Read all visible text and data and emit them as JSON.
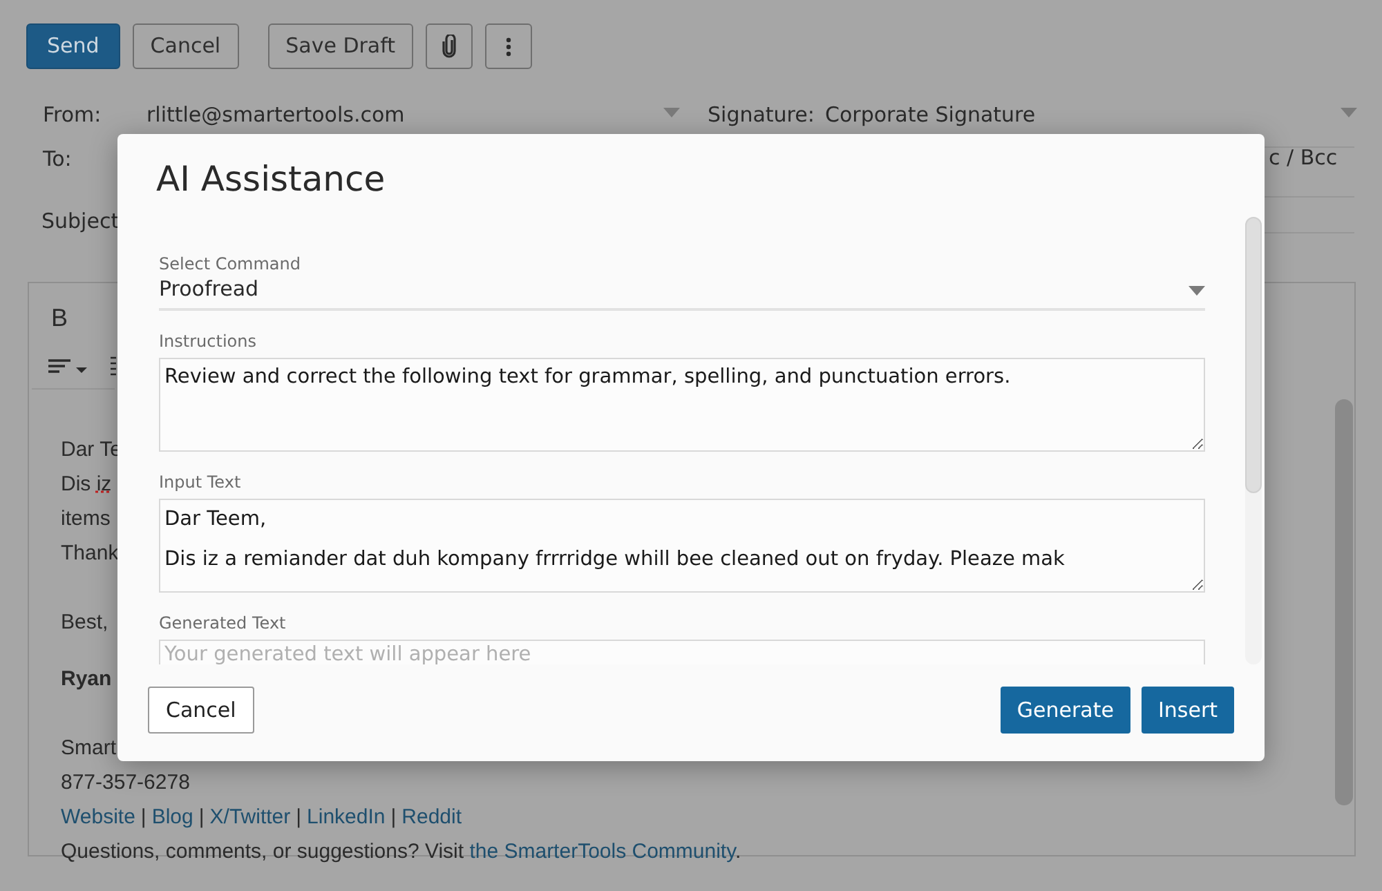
{
  "toolbar": {
    "buttons": [
      {
        "kind": "primary",
        "label": "Send"
      },
      {
        "kind": "secondary",
        "label": "Cancel"
      },
      {
        "kind": "secondary",
        "label": "Save Draft"
      },
      {
        "kind": "attach"
      },
      {
        "kind": "more"
      }
    ]
  },
  "from": {
    "label": "From:",
    "value": "rlittle@smartertools.com"
  },
  "signature": {
    "label": "Signature:",
    "value": "Corporate Signature"
  },
  "to": {
    "label": "To:",
    "cc_bcc": "c / Bcc"
  },
  "subject": {
    "label": "Subject"
  },
  "editor": {
    "bold_button": "B",
    "body": [
      {
        "kind": "text",
        "text": "Dar Te"
      },
      {
        "kind": "misspelled",
        "text": "Dis ",
        "misspelled": "iz"
      },
      {
        "kind": "text",
        "text": "items"
      },
      {
        "kind": "text",
        "text": "Thank"
      },
      {
        "kind": "gap"
      },
      {
        "kind": "text",
        "text": "Best,"
      },
      {
        "kind": "bold",
        "text": "Ryan"
      },
      {
        "kind": "gap"
      },
      {
        "kind": "text",
        "text": "Smart"
      },
      {
        "kind": "text",
        "text": "877-357-6278"
      },
      {
        "kind": "links",
        "links": [
          "Website",
          "Blog",
          "X/Twitter",
          "LinkedIn",
          "Reddit"
        ],
        "separator": "|"
      },
      {
        "kind": "sentence",
        "text": "Questions, comments, or suggestions? Visit ",
        "link": "the SmarterTools Community",
        "after": "."
      }
    ]
  },
  "dialog": {
    "title": "AI Assistance",
    "command": {
      "label": "Select Command",
      "value": "Proofread"
    },
    "instructions": {
      "label": "Instructions",
      "value": "Review and correct the following text for grammar, spelling, and punctuation errors."
    },
    "input_text": {
      "label": "Input Text",
      "lines": [
        "Dar Teem,",
        "Dis iz a remiander dat duh kompany frrrridge whill bee cleaned out on fryday. Pleaze mak"
      ]
    },
    "generated_text": {
      "label": "Generated Text",
      "placeholder": "Your generated text will appear here"
    },
    "buttons": [
      {
        "kind": "secondary",
        "label": "Cancel"
      },
      {
        "kind": "primary",
        "label": "Generate"
      },
      {
        "kind": "primary",
        "label": "Insert"
      }
    ]
  }
}
